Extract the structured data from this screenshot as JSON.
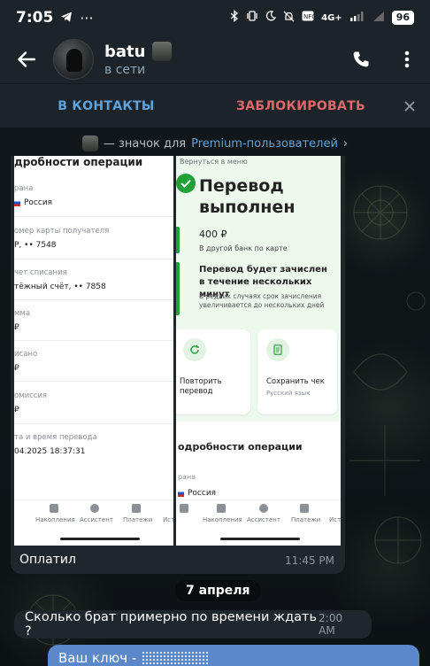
{
  "status_bar": {
    "time": "7:05",
    "extra": "···",
    "network": "4G+",
    "battery": "96"
  },
  "header": {
    "name": "batu",
    "status": "в сети"
  },
  "action_bar": {
    "add_contact": "В КОНТАКТЫ",
    "block": "ЗАБЛОКИРОВАТЬ"
  },
  "premium_hint": {
    "prefix": "— значок для",
    "link": "Premium-пользователей",
    "chevron": "›"
  },
  "photo_message": {
    "caption": "Оплатил",
    "time": "11:45 PM",
    "left_screen": {
      "title_fragment": "дробности операции",
      "rows": [
        {
          "label": "рана",
          "value": "Россия"
        },
        {
          "label": "омер карты получателя",
          "value": "Р, •• 7548"
        },
        {
          "label": "чет списания",
          "value": "тёжный счёт, •• 7858"
        },
        {
          "label": "мма",
          "value": "₽"
        },
        {
          "label": "исано",
          "value": "₽"
        },
        {
          "label": "омиссия",
          "value": "₽"
        },
        {
          "label": "та и время перевода",
          "value": "04.2025 18:37:31"
        }
      ],
      "nav": [
        "Накопления",
        "Ассистент",
        "Платежи",
        "Исто"
      ]
    },
    "right_screen": {
      "back": "Вернуться в меню",
      "title": "Перевод выполнен",
      "amount": "400 ₽",
      "amount_sub": "В другой банк по карте",
      "notice": "Перевод будет зачислен в течение нескольких минут",
      "notice_sub": "В редких случаях срок зачисления увеличивается до нескольких дней",
      "card_repeat": "Повторить перевод",
      "card_save": "Сохранить чек",
      "card_save_sub": "Русский язык",
      "details_title": "одробности операции",
      "country_label": "рана",
      "country": "Россия",
      "nav": [
        "Накопления",
        "Ассистент",
        "Платежи",
        "Исто"
      ]
    }
  },
  "date_separator": "7 апреля",
  "incoming_message": {
    "text": "Сколько брат примерно по времени ждать ?",
    "time": "2:00 AM"
  },
  "outgoing_message": {
    "text": "Ваш ключ -"
  },
  "colors": {
    "header_bg": "#1d2429",
    "link_blue": "#5fa3de",
    "danger_red": "#e3666b",
    "bubble_in": "#1f272d",
    "bubble_out": "#5a88c8",
    "sber_green": "#21a038"
  }
}
